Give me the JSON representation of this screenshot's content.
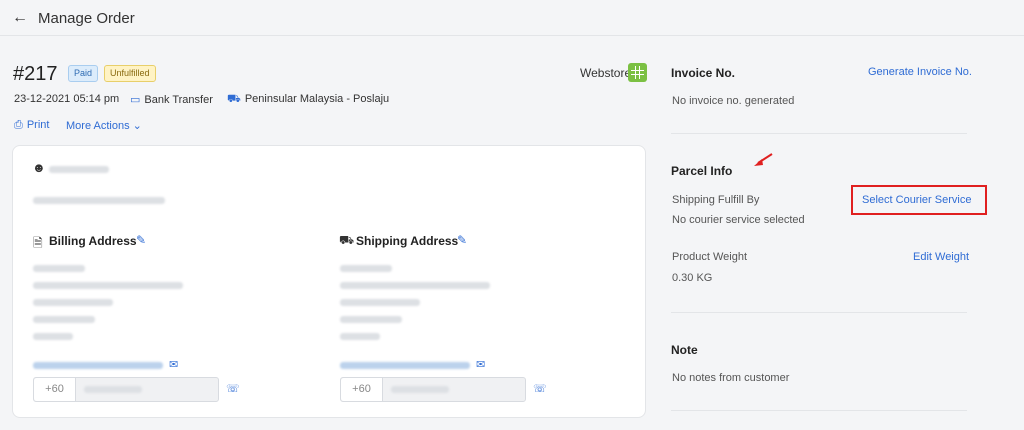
{
  "header": {
    "back_icon": "arrow-left-icon",
    "title": "Manage Order"
  },
  "order": {
    "number": "#217",
    "payment_status": "Paid",
    "fulfillment_status": "Unfulfilled",
    "channel": "Webstore",
    "date": "23-12-2021 05:14 pm",
    "payment_method": "Bank Transfer",
    "shipping_method": "Peninsular Malaysia - Poslaju"
  },
  "actions": {
    "print_label": "Print",
    "more_actions_label": "More Actions"
  },
  "customer": {
    "billing_title": "Billing Address",
    "shipping_title": "Shipping Address",
    "billing_phone_code": "+60",
    "shipping_phone_code": "+60"
  },
  "invoice": {
    "title": "Invoice No.",
    "generate_label": "Generate Invoice No.",
    "empty_text": "No invoice no. generated"
  },
  "parcel": {
    "title": "Parcel Info",
    "fulfill_label": "Shipping Fulfill By",
    "select_courier_label": "Select Courier Service",
    "no_courier_text": "No courier service selected",
    "weight_label": "Product Weight",
    "edit_weight_label": "Edit Weight",
    "weight_value": "0.30 KG"
  },
  "note": {
    "title": "Note",
    "empty_text": "No notes from customer"
  },
  "colors": {
    "accent": "#2f6cd4",
    "highlight": "#e02020",
    "paid_badge": "#dcecfb",
    "unfulfilled_badge": "#fff3c4"
  }
}
